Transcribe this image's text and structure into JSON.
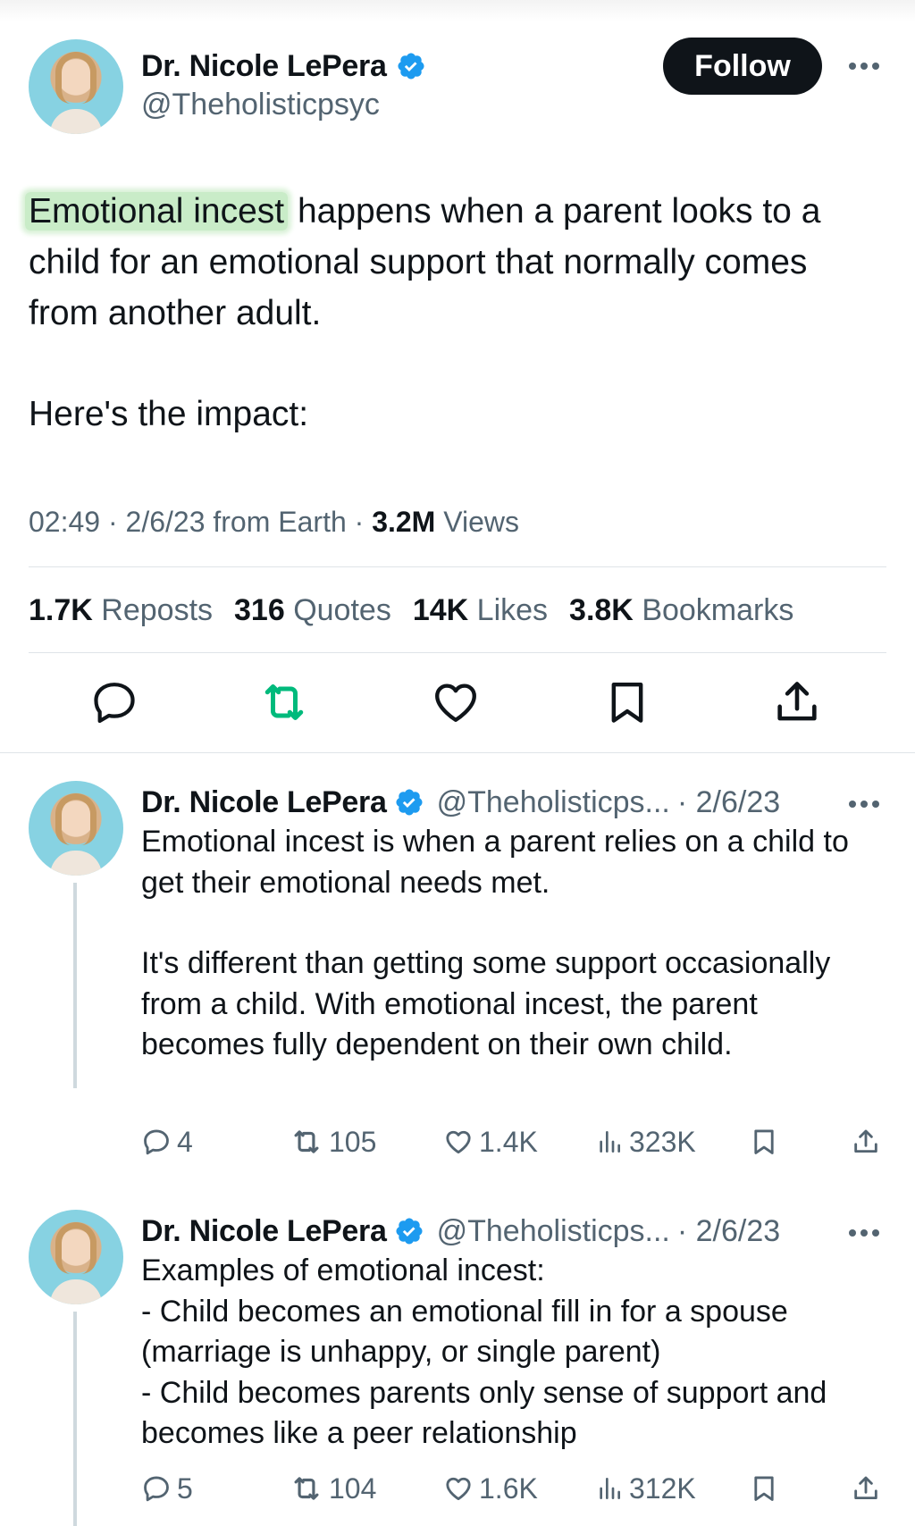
{
  "main_tweet": {
    "author_name": "Dr. Nicole LePera",
    "handle": "@Theholisticpsyc",
    "follow_label": "Follow",
    "highlight": "Emotional incest",
    "text_rest": " happens when a parent looks to a child for an emotional support that normally comes from another adult.",
    "text_second": "Here's the impact:",
    "time": "02:49",
    "date": "2/6/23",
    "location": "from Earth",
    "views_count": "3.2M",
    "views_label": "Views",
    "stats": {
      "reposts_count": "1.7K",
      "reposts_label": "Reposts",
      "quotes_count": "316",
      "quotes_label": "Quotes",
      "likes_count": "14K",
      "likes_label": "Likes",
      "bookmarks_count": "3.8K",
      "bookmarks_label": "Bookmarks"
    },
    "action_icons": [
      "reply-icon",
      "repost-icon",
      "like-icon",
      "bookmark-icon",
      "share-icon"
    ]
  },
  "replies": [
    {
      "author_name": "Dr. Nicole LePera",
      "handle": "@Theholisticps...",
      "date": "· 2/6/23",
      "paragraph1": "Emotional incest is when a parent relies on a child to get their emotional needs met.",
      "paragraph2": "It's different than getting some support occasionally from a child. With emotional incest, the parent becomes fully dependent on their own child.",
      "replies_count": "4",
      "reposts_count": "105",
      "likes_count": "1.4K",
      "views_count": "323K"
    },
    {
      "author_name": "Dr. Nicole LePera",
      "handle": "@Theholisticps...",
      "date": "· 2/6/23",
      "line1": "Examples of emotional incest:",
      "line2": "- Child becomes an emotional fill in for a spouse (marriage is unhappy, or single parent)",
      "line3": "- Child becomes parents only sense of support and becomes like a peer relationship",
      "replies_count": "5",
      "reposts_count": "104",
      "likes_count": "1.6K",
      "views_count": "312K"
    }
  ],
  "colors": {
    "text": "#0f1419",
    "secondary": "#536471",
    "verified": "#1d9bf0",
    "repost_active": "#00ba7c",
    "highlight": "#c9ecc8",
    "follow_button": "#0f1419"
  }
}
